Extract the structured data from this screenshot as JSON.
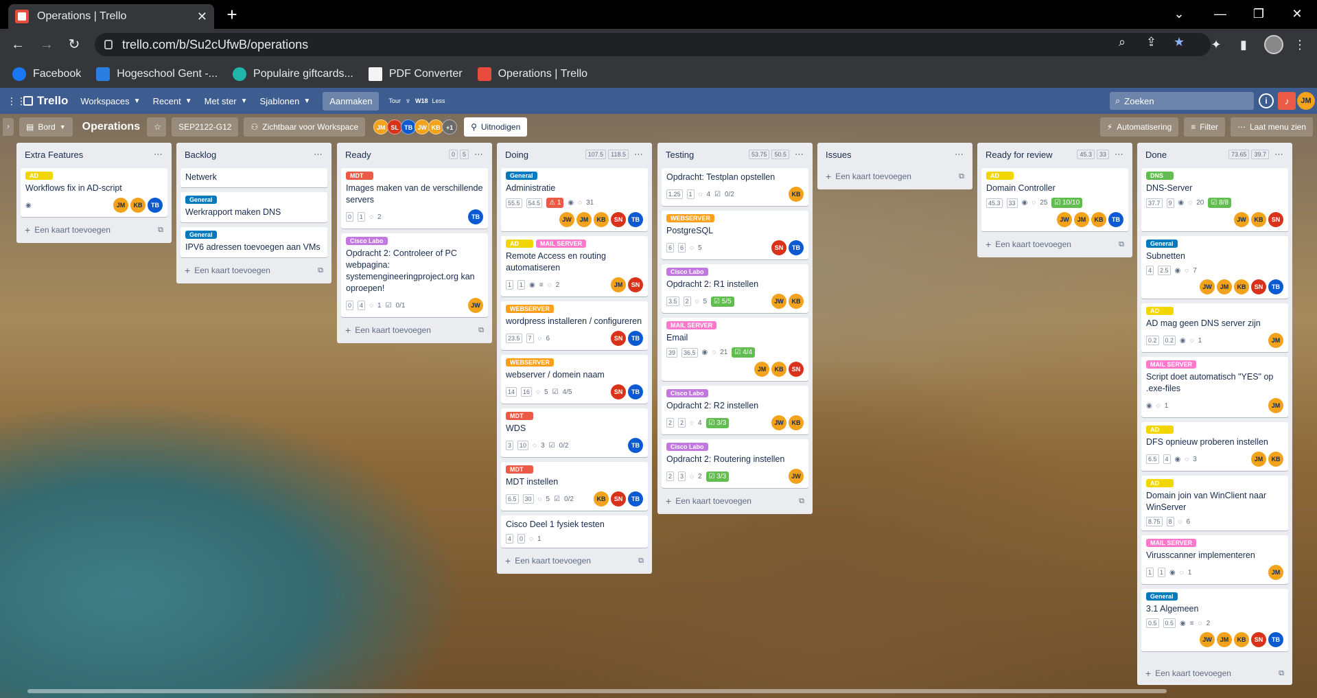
{
  "browser": {
    "tab_title": "Operations | Trello",
    "url": "trello.com/b/Su2cUfwB/operations",
    "bookmarks": [
      "Facebook",
      "Hogeschool Gent -...",
      "Populaire giftcards...",
      "PDF Converter",
      "Operations | Trello"
    ]
  },
  "header": {
    "logo": "Trello",
    "menus": [
      "Workspaces",
      "Recent",
      "Met ster",
      "Sjablonen"
    ],
    "create": "Aanmaken",
    "tour": "Tour",
    "week": "W18",
    "less": "Less",
    "search_placeholder": "Zoeken",
    "avatar": "JM"
  },
  "board": {
    "view": "Bord",
    "title": "Operations",
    "tag": "SEP2122-G12",
    "visibility": "Zichtbaar voor Workspace",
    "members": [
      "JM",
      "SL",
      "TB",
      "JW",
      "KB"
    ],
    "members_more": "+1",
    "invite": "Uitnodigen",
    "automation": "Automatisering",
    "filter": "Filter",
    "show_menu": "Laat menu zien",
    "add_card": "Een kaart toevoegen"
  },
  "lists": [
    {
      "title": "Extra Features",
      "est": [],
      "cards": [
        {
          "labels": [
            "AD"
          ],
          "title": "Workflows fix in AD-script",
          "badges": {
            "watch": true
          },
          "members": [
            "JM",
            "KB",
            "TB"
          ]
        }
      ]
    },
    {
      "title": "Backlog",
      "est": [],
      "cards": [
        {
          "labels": [],
          "title": "Netwerk",
          "badges": {},
          "members": []
        },
        {
          "labels": [
            "General"
          ],
          "title": "Werkrapport maken DNS",
          "badges": {},
          "members": []
        },
        {
          "labels": [
            "General"
          ],
          "title": "IPV6 adressen toevoegen aan VMs",
          "badges": {},
          "members": []
        }
      ]
    },
    {
      "title": "Ready",
      "est": [
        "0",
        "5"
      ],
      "cards": [
        {
          "labels": [
            "MDT"
          ],
          "title": "Images maken van de verschillende servers",
          "badges": {
            "est": [
              "0",
              "1"
            ],
            "comments": "2"
          },
          "members": [
            "TB"
          ]
        },
        {
          "labels": [
            "Cisco Labo"
          ],
          "title": "Opdracht 2: Controleer of PC webpagina: systemengineeringproject.org kan oproepen!",
          "badges": {
            "est": [
              "0",
              "4"
            ],
            "comments": "1",
            "checklist": "0/1"
          },
          "members": [
            "JW"
          ]
        }
      ]
    },
    {
      "title": "Doing",
      "est": [
        "107.5",
        "118.5"
      ],
      "cards": [
        {
          "labels": [
            "General"
          ],
          "title": "Administratie",
          "badges": {
            "est": [
              "55.5",
              "54.5"
            ],
            "alert": "1",
            "watch": true,
            "comments": "31"
          },
          "members": [
            "JW",
            "JM",
            "KB",
            "SN",
            "TB"
          ]
        },
        {
          "labels": [
            "AD",
            "MAIL SERVER"
          ],
          "title": "Remote Access en routing automatiseren",
          "badges": {
            "est": [
              "1",
              "1"
            ],
            "watch": true,
            "desc": true,
            "comments": "2"
          },
          "members": [
            "JM",
            "SN"
          ]
        },
        {
          "labels": [
            "WEBSERVER"
          ],
          "title": "wordpress installeren / configureren",
          "badges": {
            "est": [
              "23.5",
              "7"
            ],
            "comments": "6"
          },
          "members": [
            "SN",
            "TB"
          ]
        },
        {
          "labels": [
            "WEBSERVER"
          ],
          "title": "webserver / domein naam",
          "badges": {
            "est": [
              "14",
              "16"
            ],
            "comments": "5",
            "checklist": "4/5"
          },
          "members": [
            "SN",
            "TB"
          ]
        },
        {
          "labels": [
            "MDT"
          ],
          "title": "WDS",
          "badges": {
            "est": [
              "3",
              "10"
            ],
            "comments": "3",
            "checklist": "0/2"
          },
          "members": [
            "TB"
          ]
        },
        {
          "labels": [
            "MDT"
          ],
          "title": "MDT instellen",
          "badges": {
            "est": [
              "6.5",
              "30"
            ],
            "comments": "5",
            "checklist": "0/2"
          },
          "members": [
            "KB",
            "SN",
            "TB"
          ]
        },
        {
          "labels": [],
          "title": "Cisco Deel 1 fysiek testen",
          "badges": {
            "est": [
              "4",
              "0"
            ],
            "comments": "1"
          },
          "members": []
        }
      ]
    },
    {
      "title": "Testing",
      "est": [
        "53.75",
        "50.5"
      ],
      "cards": [
        {
          "labels": [],
          "title": "Opdracht: Testplan opstellen",
          "badges": {
            "est": [
              "1.25",
              "1"
            ],
            "comments": "4",
            "checklist": "0/2"
          },
          "members": [
            "KB"
          ]
        },
        {
          "labels": [
            "WEBSERVER"
          ],
          "title": "PostgreSQL",
          "badges": {
            "est": [
              "6",
              "6"
            ],
            "comments": "5"
          },
          "members": [
            "SN",
            "TB"
          ]
        },
        {
          "labels": [
            "Cisco Labo"
          ],
          "title": "Opdracht 2: R1 instellen",
          "badges": {
            "est": [
              "3.5",
              "2"
            ],
            "comments": "5",
            "checklist_done": "5/5"
          },
          "members": [
            "JW",
            "KB"
          ]
        },
        {
          "labels": [
            "MAIL SERVER"
          ],
          "title": "Email",
          "badges": {
            "est": [
              "39",
              "36.5"
            ],
            "watch": true,
            "comments": "21",
            "checklist_done": "4/4"
          },
          "members": [
            "JM",
            "KB",
            "SN"
          ]
        },
        {
          "labels": [
            "Cisco Labo"
          ],
          "title": "Opdracht 2: R2 instellen",
          "badges": {
            "est": [
              "2",
              "2"
            ],
            "comments": "4",
            "checklist_done": "3/3"
          },
          "members": [
            "JW",
            "KB"
          ]
        },
        {
          "labels": [
            "Cisco Labo"
          ],
          "title": "Opdracht 2: Routering instellen",
          "badges": {
            "est": [
              "2",
              "3"
            ],
            "comments": "2",
            "checklist_done": "3/3"
          },
          "members": [
            "JW"
          ]
        }
      ]
    },
    {
      "title": "Issues",
      "est": [],
      "cards": []
    },
    {
      "title": "Ready for review",
      "est": [
        "45.3",
        "33"
      ],
      "cards": [
        {
          "labels": [
            "AD"
          ],
          "title": "Domain Controller",
          "badges": {
            "est": [
              "45.3",
              "33"
            ],
            "watch": true,
            "comments": "25",
            "checklist_done": "10/10"
          },
          "members": [
            "JW",
            "JM",
            "KB",
            "TB"
          ]
        }
      ]
    },
    {
      "title": "Done",
      "est": [
        "73.65",
        "39.7"
      ],
      "cards": [
        {
          "labels": [
            "DNS"
          ],
          "title": "DNS-Server",
          "badges": {
            "est": [
              "37.7",
              "9"
            ],
            "watch": true,
            "comments": "20",
            "checklist_done": "8/8"
          },
          "members": [
            "JW",
            "KB",
            "SN"
          ]
        },
        {
          "labels": [
            "General"
          ],
          "title": "Subnetten",
          "badges": {
            "est": [
              "4",
              "2.5"
            ],
            "watch": true,
            "comments": "7"
          },
          "members": [
            "JW",
            "JM",
            "KB",
            "SN",
            "TB"
          ]
        },
        {
          "labels": [
            "AD"
          ],
          "title": "AD mag geen DNS server zijn",
          "badges": {
            "est": [
              "0.2",
              "0.2"
            ],
            "watch": true,
            "comments": "1"
          },
          "members": [
            "JM"
          ]
        },
        {
          "labels": [
            "MAIL SERVER"
          ],
          "title": "Script doet automatisch \"YES\" op .exe-files",
          "badges": {
            "watch": true,
            "comments": "1"
          },
          "members": [
            "JM"
          ]
        },
        {
          "labels": [
            "AD"
          ],
          "title": "DFS opnieuw proberen instellen",
          "badges": {
            "est": [
              "6.5",
              "4"
            ],
            "watch": true,
            "comments": "3"
          },
          "members": [
            "JM",
            "KB"
          ]
        },
        {
          "labels": [
            "AD"
          ],
          "title": "Domain join van WinClient naar WinServer",
          "badges": {
            "est": [
              "8.75",
              "8"
            ],
            "comments": "6"
          },
          "members": []
        },
        {
          "labels": [
            "MAIL SERVER"
          ],
          "title": "Virusscanner implementeren",
          "badges": {
            "est": [
              "1",
              "1"
            ],
            "watch": true,
            "comments": "1"
          },
          "members": [
            "JM"
          ]
        },
        {
          "labels": [
            "General"
          ],
          "title": "3.1 Algemeen",
          "badges": {
            "est": [
              "0.5",
              "0.5"
            ],
            "watch": true,
            "desc": true,
            "comments": "2"
          },
          "members": [
            "JW",
            "JM",
            "KB",
            "SN",
            "TB"
          ]
        }
      ]
    }
  ],
  "colors": {
    "header": "#3d5c8f",
    "list_bg": "#ebecf0"
  }
}
